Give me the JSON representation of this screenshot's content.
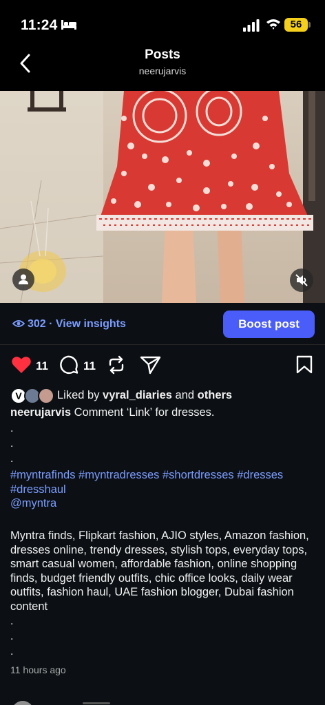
{
  "status": {
    "time": "11:24",
    "battery": "56"
  },
  "header": {
    "title": "Posts",
    "username": "neerujarvis"
  },
  "insights": {
    "text": "302 · View insights",
    "boost_label": "Boost post"
  },
  "actions": {
    "likes": "11",
    "comments": "11"
  },
  "liked_by": {
    "prefix": "Liked by ",
    "user": "vyral_diaries",
    "middle": " and ",
    "others": "others",
    "avatar_initial": "V"
  },
  "caption": {
    "username": "neerujarvis",
    "text": " Comment ‘Link’ for dresses."
  },
  "dots": ".",
  "hashtags": "#myntrafinds #myntradresses #shortdresses #dresses #dresshaul",
  "mention": "@myntra",
  "keywords": "Myntra finds, Flipkart fashion, AJIO styles, Amazon fashion, dresses online, trendy dresses, stylish tops, everyday tops, smart casual women, affordable fashion, online shopping finds, budget friendly outfits, chic office looks, daily wear outfits, fashion haul, UAE fashion blogger, Dubai fashion content",
  "timestamp": "11 hours ago",
  "colors": {
    "accent": "#4a5df9",
    "link": "#7b9cff",
    "like": "#ff3040",
    "background": "#0c1014"
  },
  "icons": [
    "back-icon",
    "bed-icon",
    "signal-icon",
    "wifi-icon",
    "eye-icon",
    "heart-icon",
    "comment-icon",
    "repost-icon",
    "share-icon",
    "bookmark-icon",
    "user-tag-icon",
    "mute-icon"
  ]
}
